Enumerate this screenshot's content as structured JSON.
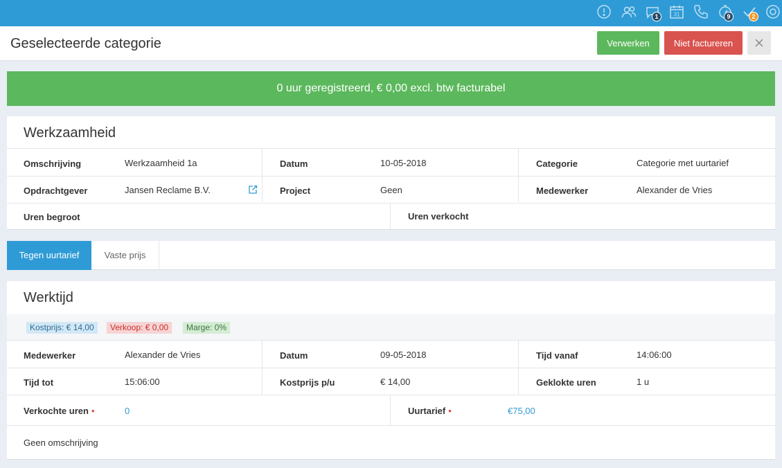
{
  "header": {
    "title": "Geselecteerde categorie",
    "process_label": "Verwerken",
    "no_invoice_label": "Niet factureren"
  },
  "topbar": {
    "icons": [
      "alert-icon",
      "users-icon",
      "chat-icon",
      "calendar-icon",
      "phone-icon",
      "timer-icon",
      "check-icon",
      "settings-icon"
    ],
    "calendar_day": "31",
    "chat_badge": "1",
    "timer_badge": "9",
    "tasks_badge": "2"
  },
  "alert": {
    "text": "0 uur geregistreerd, € 0,00 excl. btw facturabel"
  },
  "activity": {
    "title": "Werkzaamheid",
    "rows": [
      [
        {
          "label": "Omschrijving",
          "value": "Werkzaamheid 1a"
        },
        {
          "label": "Datum",
          "value": "10-05-2018"
        },
        {
          "label": "Categorie",
          "value": "Categorie met uurtarief"
        }
      ],
      [
        {
          "label": "Opdrachtgever",
          "value": "Jansen Reclame B.V."
        },
        {
          "label": "Project",
          "value": "Geen"
        },
        {
          "label": "Medewerker",
          "value": "Alexander de Vries"
        }
      ]
    ],
    "hours_budget_label": "Uren begroot",
    "hours_sold_label": "Uren verkocht"
  },
  "tabs": {
    "hourly": "Tegen uurtarief",
    "fixed": "Vaste prijs"
  },
  "worktime": {
    "title": "Werktijd",
    "tags": {
      "cost": "Kostprijs: € 14,00",
      "sale": "Verkoop: € 0,00",
      "margin": "Marge: 0%"
    },
    "rows": [
      [
        {
          "label": "Medewerker",
          "value": "Alexander de Vries"
        },
        {
          "label": "Datum",
          "value": "09-05-2018"
        },
        {
          "label": "Tijd vanaf",
          "value": "14:06:00"
        }
      ],
      [
        {
          "label": "Tijd tot",
          "value": "15:06:00"
        },
        {
          "label": "Kostprijs p/u",
          "value": "€ 14,00"
        },
        {
          "label": "Geklokte uren",
          "value": "1 u"
        }
      ]
    ],
    "sold_hours_label": "Verkochte uren",
    "sold_hours_value": "0",
    "rate_label": "Uurtarief",
    "rate_value": "€75,00",
    "required_mark": "•",
    "description": "Geen omschrijving"
  },
  "colors": {
    "primary": "#2f9bd6",
    "success": "#5cb85c",
    "danger": "#d9534f"
  }
}
